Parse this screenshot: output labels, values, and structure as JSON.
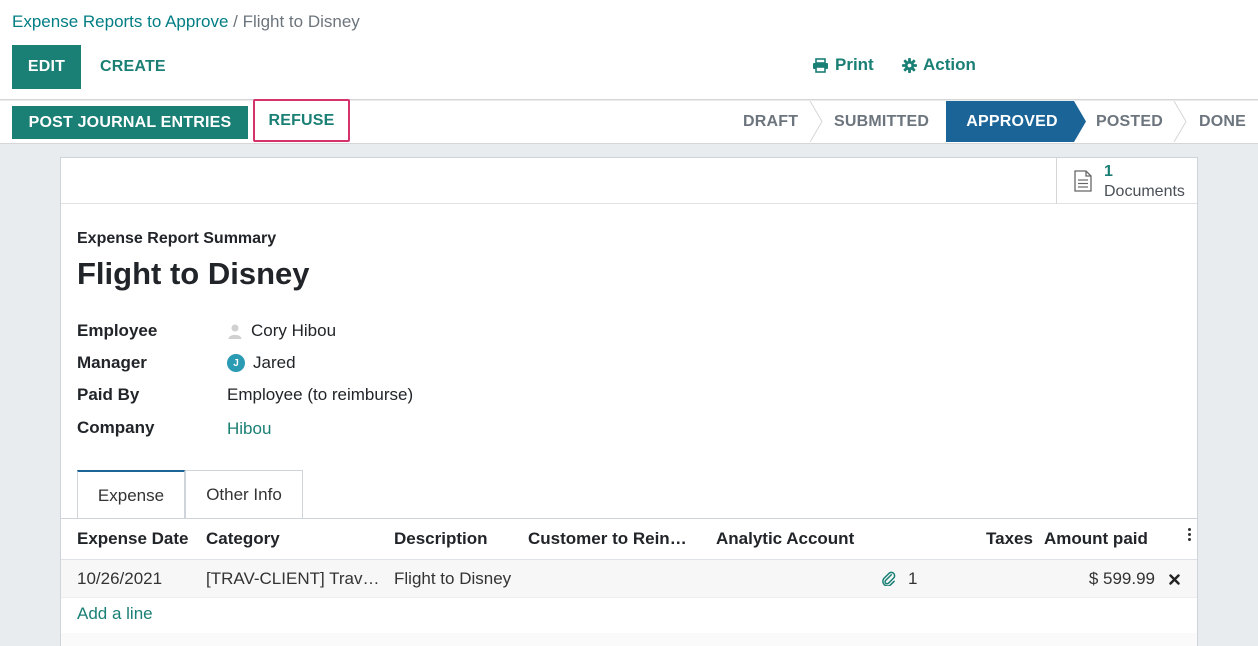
{
  "breadcrumb": {
    "parent": "Expense Reports to Approve",
    "separator": "/",
    "current": "Flight to Disney"
  },
  "toolbar": {
    "edit_label": "EDIT",
    "create_label": "CREATE",
    "print_label": "Print",
    "action_label": "Action"
  },
  "statusbar": {
    "post_label": "POST JOURNAL ENTRIES",
    "refuse_label": "REFUSE",
    "stages": [
      "DRAFT",
      "SUBMITTED",
      "APPROVED",
      "POSTED",
      "DONE"
    ],
    "active_stage": "APPROVED"
  },
  "buttonbox": {
    "doc_count": "1",
    "doc_label": "Documents"
  },
  "form": {
    "summary_label": "Expense Report Summary",
    "title": "Flight to Disney",
    "fields": [
      {
        "label": "Employee",
        "value": "Cory Hibou"
      },
      {
        "label": "Manager",
        "value": "Jared",
        "avatar_letter": "J"
      },
      {
        "label": "Paid By",
        "value": "Employee (to reimburse)"
      },
      {
        "label": "Company",
        "value": "Hibou"
      }
    ]
  },
  "tabs": [
    "Expense",
    "Other Info"
  ],
  "table": {
    "headers": [
      "Expense Date",
      "Category",
      "Description",
      "Customer to Reinvoice",
      "Analytic Account",
      "Taxes",
      "Amount paid"
    ],
    "rows": [
      {
        "date": "10/26/2021",
        "category": "[TRAV-CLIENT] Travel (Client)",
        "description": "Flight to Disney",
        "attachments": "1",
        "amount": "$ 599.99"
      }
    ],
    "add_line_label": "Add a line"
  },
  "colors": {
    "primary": "#1a7f74",
    "active_stage": "#1b6498",
    "highlight": "#d6336c",
    "link": "#017e84"
  }
}
